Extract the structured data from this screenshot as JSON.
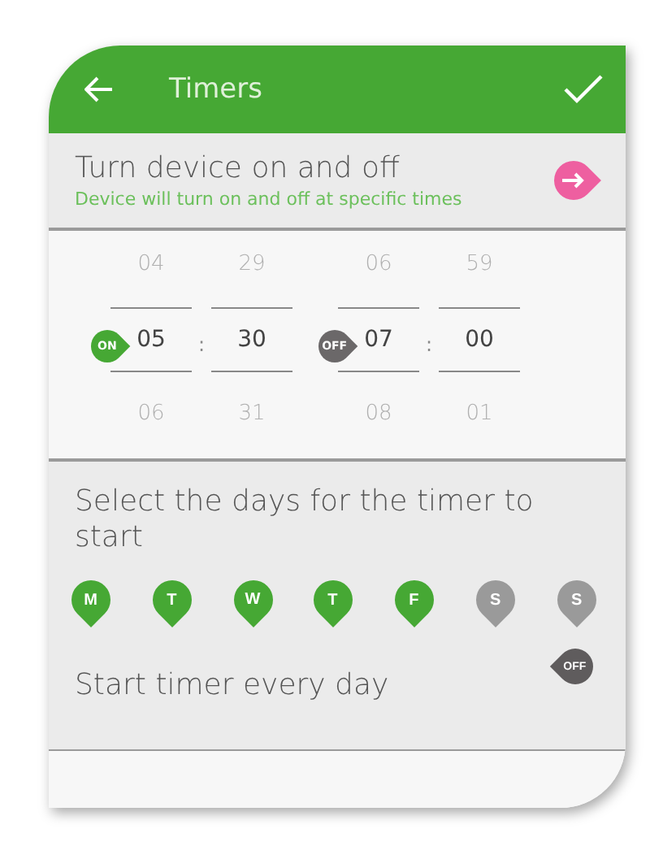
{
  "header": {
    "title": "Timers"
  },
  "intro": {
    "title": "Turn device on and off",
    "subtitle": "Device will turn on and off at specific times"
  },
  "timers": [
    {
      "badge": "ON",
      "color": "#46a834",
      "separator": ":",
      "hours": {
        "previous": "04",
        "current": "05",
        "next": "06"
      },
      "minutes": {
        "previous": "29",
        "current": "30",
        "next": "31"
      }
    },
    {
      "badge": "OFF",
      "color": "#6b6869",
      "separator": ":",
      "hours": {
        "previous": "06",
        "current": "07",
        "next": "08"
      },
      "minutes": {
        "previous": "59",
        "current": "00",
        "next": "01"
      }
    }
  ],
  "days": {
    "title": "Select the days for the timer to start",
    "items": [
      {
        "label": "M",
        "selected": true
      },
      {
        "label": "T",
        "selected": true
      },
      {
        "label": "W",
        "selected": true
      },
      {
        "label": "T",
        "selected": true
      },
      {
        "label": "F",
        "selected": true
      },
      {
        "label": "S",
        "selected": false
      },
      {
        "label": "S",
        "selected": false
      }
    ]
  },
  "every_day": {
    "label": "Start timer every day",
    "state_label": "OFF",
    "on": false
  }
}
